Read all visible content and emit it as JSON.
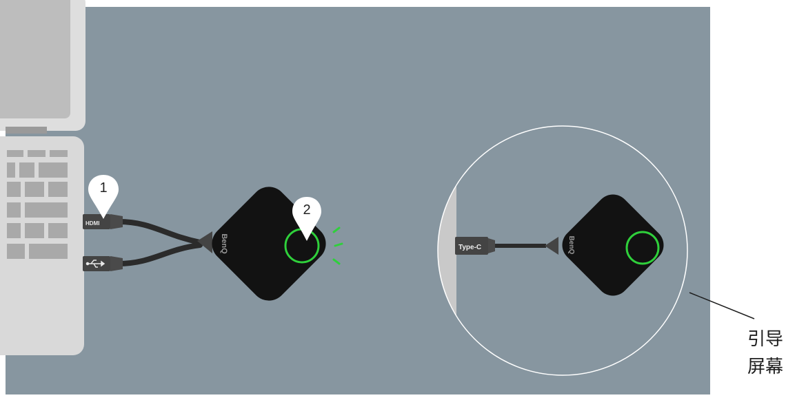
{
  "scene": {
    "background_color": "#8796a0",
    "laptop_color": "#d6d6d6",
    "dongle_color": "#111111",
    "led_ring_color": "#2fd03b",
    "cable_color": "#2b2b2b"
  },
  "pins": [
    {
      "number": "1"
    },
    {
      "number": "2"
    }
  ],
  "ports": {
    "hdmi_label": "HDMI",
    "usb_icon": "usb-icon"
  },
  "dongle": {
    "brand": "BenQ"
  },
  "zoom": {
    "port_label": "Type-C",
    "brand": "BenQ"
  },
  "callout": {
    "line1": "引导",
    "line2": "屏幕"
  }
}
